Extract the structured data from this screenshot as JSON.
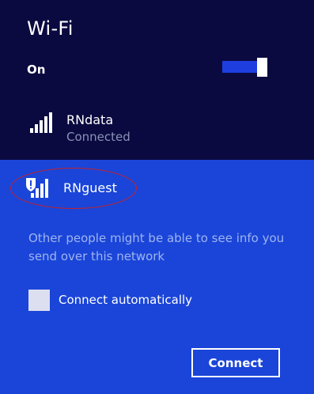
{
  "header": {
    "title": "Wi-Fi"
  },
  "wifi_toggle": {
    "label": "On",
    "state": "on"
  },
  "networks": [
    {
      "name": "RNdata",
      "status": "Connected",
      "icon": "wifi-signal-icon"
    },
    {
      "name": "RNguest",
      "status": "",
      "icon": "wifi-signal-warning-icon",
      "selected": true
    }
  ],
  "selected_network": {
    "warning": "Other people might be able to see info you send over this network",
    "auto_connect_label": "Connect automatically",
    "auto_connect_checked": false,
    "connect_label": "Connect"
  },
  "colors": {
    "top_background": "#0a0a40",
    "selected_background": "#1a45d8",
    "toggle_accent": "#1f3ee0",
    "annotation_ring": "#c8202a"
  }
}
